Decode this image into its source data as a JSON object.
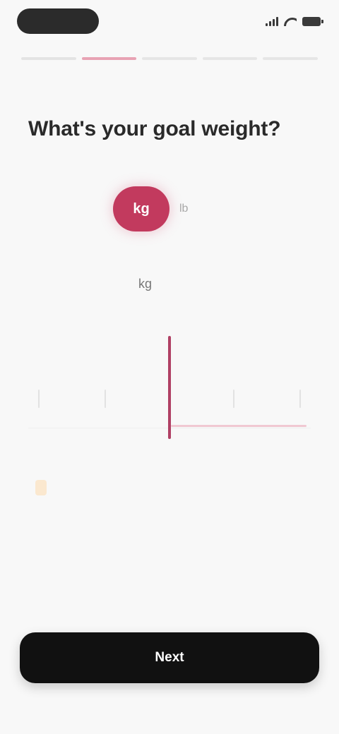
{
  "status_bar": {
    "time": "",
    "icons": [
      "cellular-signal-icon",
      "wifi-icon",
      "battery-icon"
    ]
  },
  "progress": {
    "total_steps": 5,
    "current_step": 2
  },
  "question": "What's your goal weight?",
  "unit_toggle": {
    "active": "kg",
    "inactive": "lb",
    "active_color": "#c23a5e"
  },
  "weight": {
    "value": "",
    "unit": "kg"
  },
  "tip": {
    "badge": "",
    "title": "",
    "body": ""
  },
  "cta": {
    "label": "Next"
  },
  "colors": {
    "accent": "#c23a5e",
    "background": "#f8f8f8",
    "button": "#111111"
  }
}
